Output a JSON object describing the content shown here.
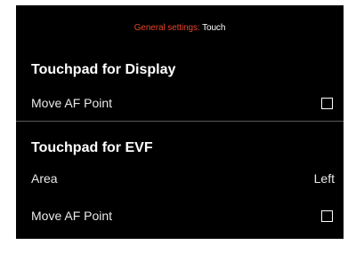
{
  "header": {
    "crumb": "General settings:",
    "current": "Touch"
  },
  "display_section": {
    "title": "Touchpad for Display",
    "rows": [
      {
        "label": "Move AF Point",
        "checked": false
      }
    ]
  },
  "evf_section": {
    "title": "Touchpad for EVF",
    "rows": [
      {
        "label": "Area",
        "value": "Left"
      },
      {
        "label": "Move AF Point",
        "checked": false
      }
    ]
  },
  "colors": {
    "background": "#000000",
    "accent": "#e0452a",
    "text": "#ffffff",
    "divider": "#5a5a5a"
  }
}
